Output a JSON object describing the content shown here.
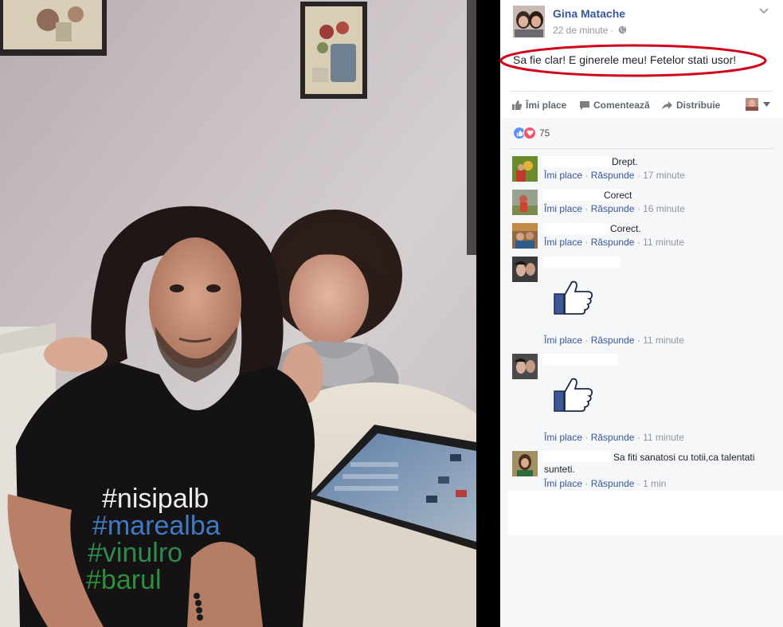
{
  "post": {
    "author": "Gina Matache",
    "time": "22 de minute",
    "dot": "·",
    "text": "Sa fie clar! E ginerele meu! Fetelor stati usor!"
  },
  "photo": {
    "shirt_lines": [
      "#nisipalb",
      "#marealba",
      "#vinulro",
      "#barul"
    ]
  },
  "actions": {
    "like": "Îmi place",
    "comment": "Comentează",
    "share": "Distribuie"
  },
  "reactions": {
    "count": "75"
  },
  "comments": [
    {
      "text": "Drept.",
      "like": "Îmi place",
      "sep": "·",
      "reply": "Răspunde",
      "time": "17 minute"
    },
    {
      "text": "Corect",
      "like": "Îmi place",
      "sep": "·",
      "reply": "Răspunde",
      "time": "16 minute"
    },
    {
      "text": "Corect.",
      "like": "Îmi place",
      "sep": "·",
      "reply": "Răspunde",
      "time": "11 minute"
    },
    {
      "sticker": "thumbs-up",
      "like": "Îmi place",
      "sep": "·",
      "reply": "Răspunde",
      "time": "11 minute"
    },
    {
      "sticker": "thumbs-up",
      "like": "Îmi place",
      "sep": "·",
      "reply": "Răspunde",
      "time": "11 minute"
    },
    {
      "text_line1": "Sa fiti sanatosi cu totii,ca talentati",
      "text_line2": "sunteti.",
      "like": "Îmi place",
      "sep": "·",
      "reply": "Răspunde",
      "time": "1 min"
    }
  ],
  "colors": {
    "link": "#365899",
    "muted": "#90949c",
    "highlight": "#d0021b",
    "like_blue": "#5890ff",
    "love_red": "#f25268"
  }
}
